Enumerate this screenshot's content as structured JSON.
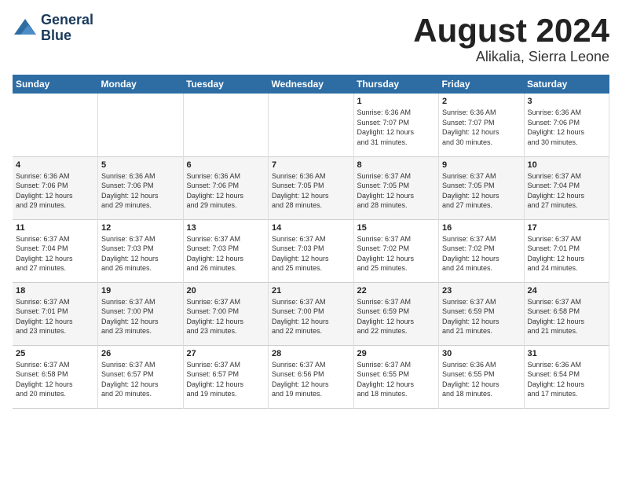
{
  "header": {
    "logo_line1": "General",
    "logo_line2": "Blue",
    "month": "August 2024",
    "location": "Alikalia, Sierra Leone"
  },
  "weekdays": [
    "Sunday",
    "Monday",
    "Tuesday",
    "Wednesday",
    "Thursday",
    "Friday",
    "Saturday"
  ],
  "weeks": [
    [
      {
        "day": "",
        "info": ""
      },
      {
        "day": "",
        "info": ""
      },
      {
        "day": "",
        "info": ""
      },
      {
        "day": "",
        "info": ""
      },
      {
        "day": "1",
        "info": "Sunrise: 6:36 AM\nSunset: 7:07 PM\nDaylight: 12 hours\nand 31 minutes."
      },
      {
        "day": "2",
        "info": "Sunrise: 6:36 AM\nSunset: 7:07 PM\nDaylight: 12 hours\nand 30 minutes."
      },
      {
        "day": "3",
        "info": "Sunrise: 6:36 AM\nSunset: 7:06 PM\nDaylight: 12 hours\nand 30 minutes."
      }
    ],
    [
      {
        "day": "4",
        "info": "Sunrise: 6:36 AM\nSunset: 7:06 PM\nDaylight: 12 hours\nand 29 minutes."
      },
      {
        "day": "5",
        "info": "Sunrise: 6:36 AM\nSunset: 7:06 PM\nDaylight: 12 hours\nand 29 minutes."
      },
      {
        "day": "6",
        "info": "Sunrise: 6:36 AM\nSunset: 7:06 PM\nDaylight: 12 hours\nand 29 minutes."
      },
      {
        "day": "7",
        "info": "Sunrise: 6:36 AM\nSunset: 7:05 PM\nDaylight: 12 hours\nand 28 minutes."
      },
      {
        "day": "8",
        "info": "Sunrise: 6:37 AM\nSunset: 7:05 PM\nDaylight: 12 hours\nand 28 minutes."
      },
      {
        "day": "9",
        "info": "Sunrise: 6:37 AM\nSunset: 7:05 PM\nDaylight: 12 hours\nand 27 minutes."
      },
      {
        "day": "10",
        "info": "Sunrise: 6:37 AM\nSunset: 7:04 PM\nDaylight: 12 hours\nand 27 minutes."
      }
    ],
    [
      {
        "day": "11",
        "info": "Sunrise: 6:37 AM\nSunset: 7:04 PM\nDaylight: 12 hours\nand 27 minutes."
      },
      {
        "day": "12",
        "info": "Sunrise: 6:37 AM\nSunset: 7:03 PM\nDaylight: 12 hours\nand 26 minutes."
      },
      {
        "day": "13",
        "info": "Sunrise: 6:37 AM\nSunset: 7:03 PM\nDaylight: 12 hours\nand 26 minutes."
      },
      {
        "day": "14",
        "info": "Sunrise: 6:37 AM\nSunset: 7:03 PM\nDaylight: 12 hours\nand 25 minutes."
      },
      {
        "day": "15",
        "info": "Sunrise: 6:37 AM\nSunset: 7:02 PM\nDaylight: 12 hours\nand 25 minutes."
      },
      {
        "day": "16",
        "info": "Sunrise: 6:37 AM\nSunset: 7:02 PM\nDaylight: 12 hours\nand 24 minutes."
      },
      {
        "day": "17",
        "info": "Sunrise: 6:37 AM\nSunset: 7:01 PM\nDaylight: 12 hours\nand 24 minutes."
      }
    ],
    [
      {
        "day": "18",
        "info": "Sunrise: 6:37 AM\nSunset: 7:01 PM\nDaylight: 12 hours\nand 23 minutes."
      },
      {
        "day": "19",
        "info": "Sunrise: 6:37 AM\nSunset: 7:00 PM\nDaylight: 12 hours\nand 23 minutes."
      },
      {
        "day": "20",
        "info": "Sunrise: 6:37 AM\nSunset: 7:00 PM\nDaylight: 12 hours\nand 23 minutes."
      },
      {
        "day": "21",
        "info": "Sunrise: 6:37 AM\nSunset: 7:00 PM\nDaylight: 12 hours\nand 22 minutes."
      },
      {
        "day": "22",
        "info": "Sunrise: 6:37 AM\nSunset: 6:59 PM\nDaylight: 12 hours\nand 22 minutes."
      },
      {
        "day": "23",
        "info": "Sunrise: 6:37 AM\nSunset: 6:59 PM\nDaylight: 12 hours\nand 21 minutes."
      },
      {
        "day": "24",
        "info": "Sunrise: 6:37 AM\nSunset: 6:58 PM\nDaylight: 12 hours\nand 21 minutes."
      }
    ],
    [
      {
        "day": "25",
        "info": "Sunrise: 6:37 AM\nSunset: 6:58 PM\nDaylight: 12 hours\nand 20 minutes."
      },
      {
        "day": "26",
        "info": "Sunrise: 6:37 AM\nSunset: 6:57 PM\nDaylight: 12 hours\nand 20 minutes."
      },
      {
        "day": "27",
        "info": "Sunrise: 6:37 AM\nSunset: 6:57 PM\nDaylight: 12 hours\nand 19 minutes."
      },
      {
        "day": "28",
        "info": "Sunrise: 6:37 AM\nSunset: 6:56 PM\nDaylight: 12 hours\nand 19 minutes."
      },
      {
        "day": "29",
        "info": "Sunrise: 6:37 AM\nSunset: 6:55 PM\nDaylight: 12 hours\nand 18 minutes."
      },
      {
        "day": "30",
        "info": "Sunrise: 6:36 AM\nSunset: 6:55 PM\nDaylight: 12 hours\nand 18 minutes."
      },
      {
        "day": "31",
        "info": "Sunrise: 6:36 AM\nSunset: 6:54 PM\nDaylight: 12 hours\nand 17 minutes."
      }
    ]
  ]
}
